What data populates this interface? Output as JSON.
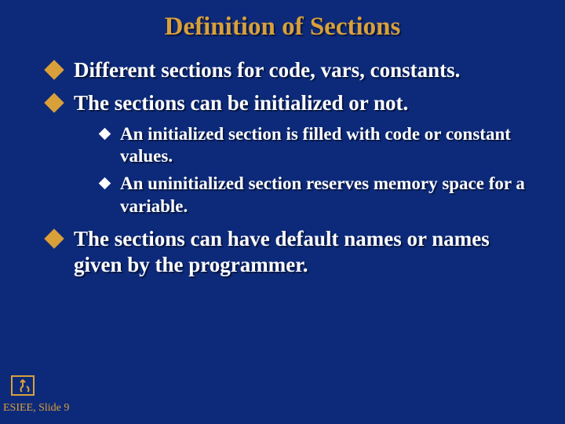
{
  "title": "Definition of Sections",
  "bullets": {
    "b1": "Different sections for code, vars, constants.",
    "b2": "The sections can be initialized or not.",
    "b2_sub1": "An initialized section is filled with code or constant values.",
    "b2_sub2": "An uninitialized section reserves memory space for a variable.",
    "b3": "The sections can have default names or names given by the programmer."
  },
  "footer": "ESIEE, Slide 9"
}
